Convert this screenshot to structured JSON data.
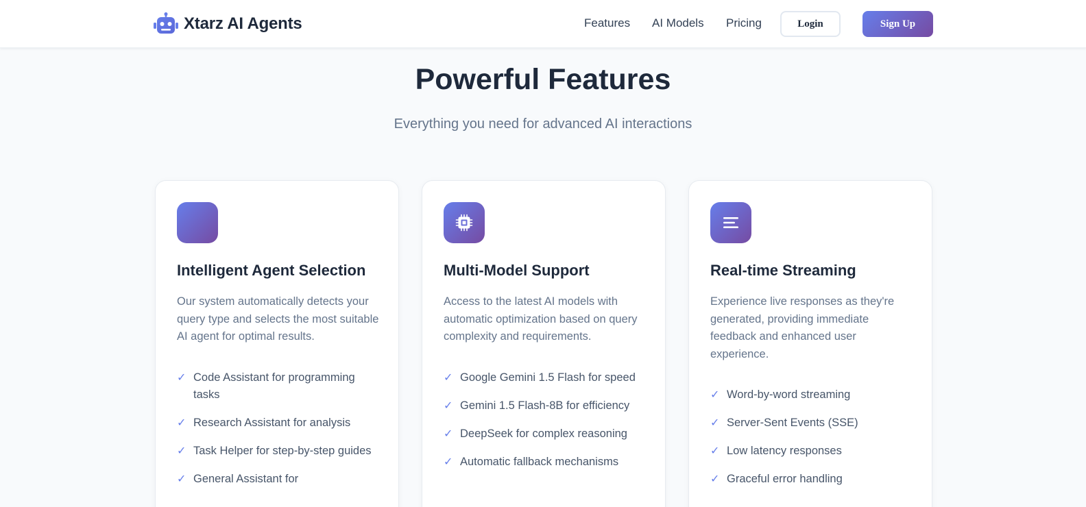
{
  "brand": {
    "name": "Xtarz AI Agents",
    "icon": "robot-icon"
  },
  "nav": {
    "links": [
      "Features",
      "AI Models",
      "Pricing"
    ],
    "login_label": "Login",
    "signup_label": "Sign Up"
  },
  "features_section": {
    "title": "Powerful Features",
    "subtitle": "Everything you need for advanced AI interactions"
  },
  "cards": [
    {
      "icon": "brain-icon",
      "title": "Intelligent Agent Selection",
      "description": "Our system automatically detects your query type and selects the most suitable AI agent for optimal results.",
      "items": [
        "Code Assistant for programming tasks",
        "Research Assistant for analysis",
        "Task Helper for step-by-step guides",
        "General Assistant for"
      ]
    },
    {
      "icon": "microchip-icon",
      "title": "Multi-Model Support",
      "description": "Access to the latest AI models with automatic optimization based on query complexity and requirements.",
      "items": [
        "Google Gemini 1.5 Flash for speed",
        "Gemini 1.5 Flash-8B for efficiency",
        "DeepSeek for complex reasoning",
        "Automatic fallback mechanisms"
      ]
    },
    {
      "icon": "stream-icon",
      "title": "Real-time Streaming",
      "description": "Experience live responses as they're generated, providing immediate feedback and enhanced user experience.",
      "items": [
        "Word-by-word streaming",
        "Server-Sent Events (SSE)",
        "Low latency responses",
        "Graceful error handling"
      ]
    }
  ],
  "colors": {
    "accent_start": "#667eea",
    "accent_end": "#764ba2",
    "heading": "#1e293b",
    "muted": "#64748b",
    "background": "#f8fafc"
  }
}
